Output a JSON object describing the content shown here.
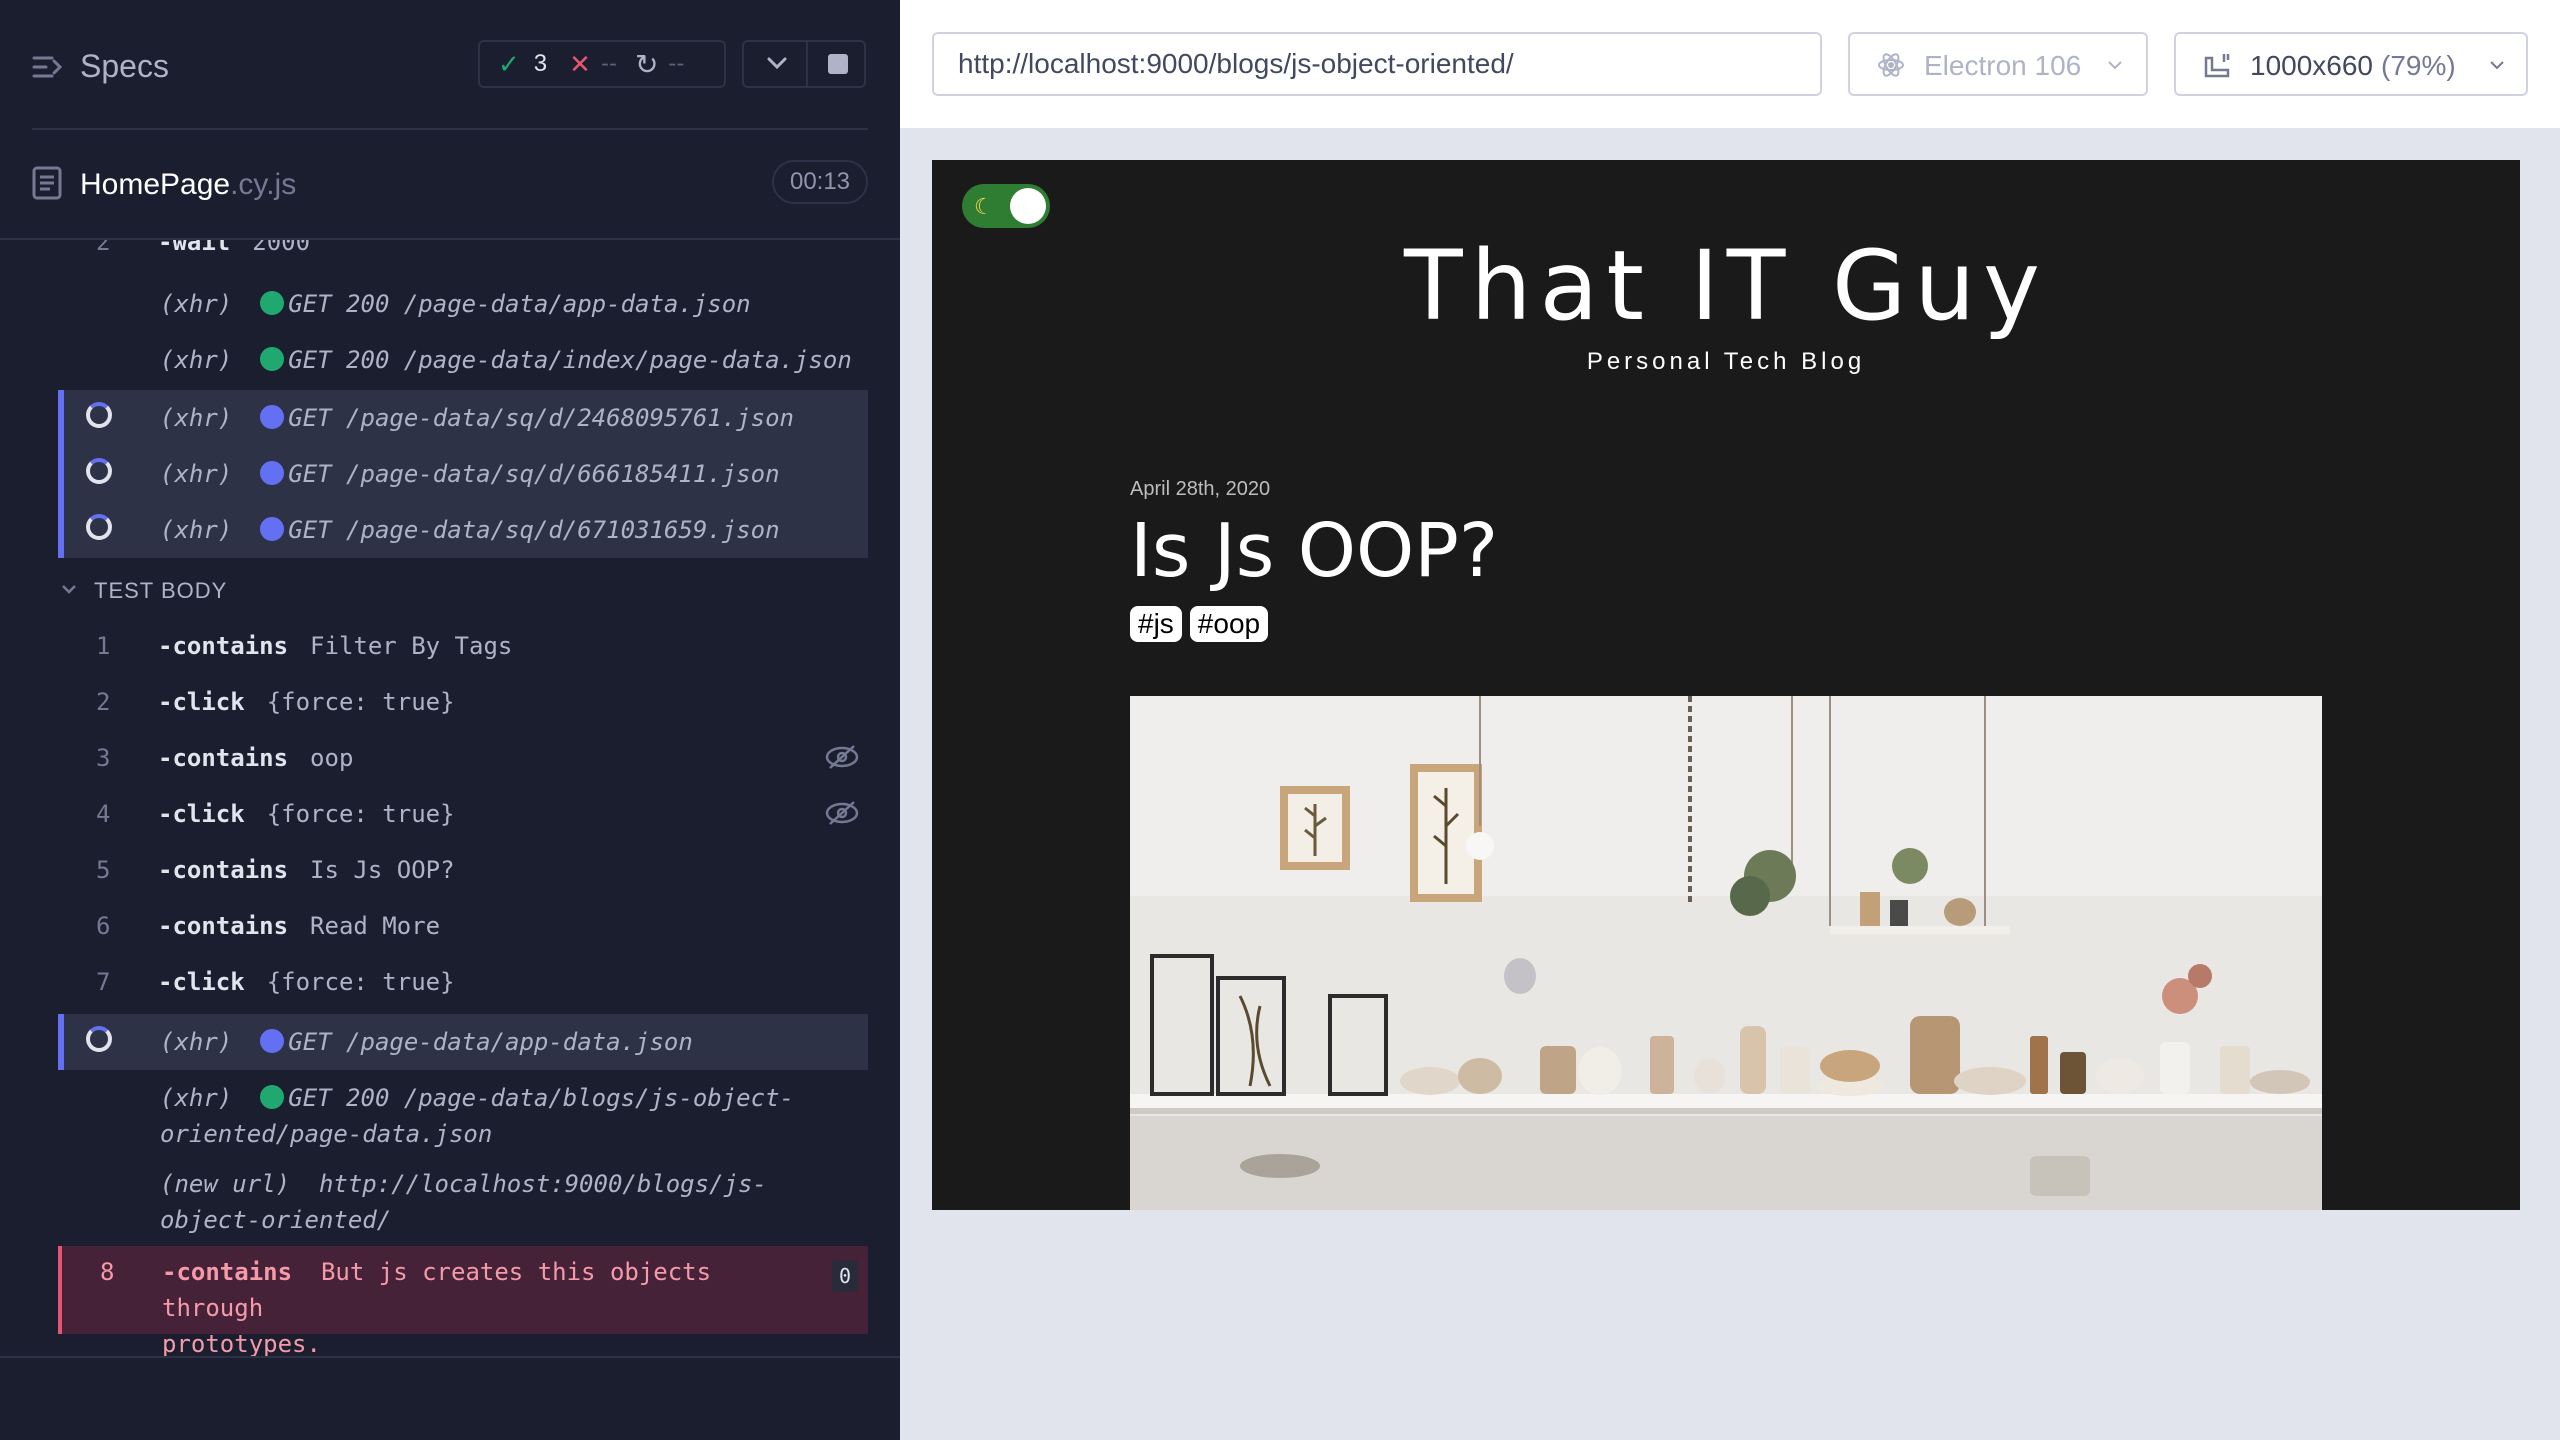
{
  "reporter": {
    "specs_label": "Specs",
    "stats": {
      "passed": "3",
      "failed": "--",
      "pending": "--"
    },
    "spec": {
      "name": "HomePage",
      "ext": ".cy.js",
      "duration": "00:13"
    },
    "partial_command": {
      "num": "2",
      "method": "-wait",
      "message": "2000"
    },
    "before_commands": [
      {
        "type": "(xhr)",
        "status": "GET 200 /page-data/app-data.json",
        "state": "done"
      },
      {
        "type": "(xhr)",
        "status": "GET 200 /page-data/index/page-data.json",
        "state": "done"
      },
      {
        "type": "(xhr)",
        "status": "GET /page-data/sq/d/2468095761.json",
        "state": "pending"
      },
      {
        "type": "(xhr)",
        "status": "GET /page-data/sq/d/666185411.json",
        "state": "pending"
      },
      {
        "type": "(xhr)",
        "status": "GET /page-data/sq/d/671031659.json",
        "state": "pending"
      }
    ],
    "test_body_label": "TEST BODY",
    "commands": [
      {
        "num": "1",
        "method": "-contains",
        "message": "Filter By Tags"
      },
      {
        "num": "2",
        "method": "-click",
        "message": "{force: true}"
      },
      {
        "num": "3",
        "method": "-contains",
        "message": "oop"
      },
      {
        "num": "4",
        "method": "-click",
        "message": "{force: true}"
      },
      {
        "num": "5",
        "method": "-contains",
        "message": "Is Js OOP?"
      },
      {
        "num": "6",
        "method": "-contains",
        "message": "Read More"
      },
      {
        "num": "7",
        "method": "-click",
        "message": "{force: true}"
      }
    ],
    "after_xhr": {
      "type": "(xhr)",
      "status": "GET /page-data/app-data.json"
    },
    "xhr_done_line1": "(xhr)  GET 200 /page-data/blogs/js-object-",
    "xhr_done_type": "(xhr)",
    "xhr_done_status": "GET 200 /page-data/blogs/js-object-",
    "xhr_done_line2": "oriented/page-data.json",
    "new_url_type": "(new url)",
    "new_url_line1": "http://localhost:9000/blogs/js-",
    "new_url_line2": "object-oriented/",
    "failed_command": {
      "num": "8",
      "method": "-contains",
      "message_line1": "But js creates this objects through",
      "message_line2": "prototypes.",
      "badge": "0"
    }
  },
  "aut": {
    "url": "http://localhost:9000/blogs/js-object-oriented/",
    "browser": "Electron 106",
    "viewport": "1000x660",
    "viewport_pct": "(79%)",
    "site": {
      "title": "That IT Guy",
      "subtitle": "Personal Tech Blog",
      "post_date": "April 28th, 2020",
      "post_title": "Is Js OOP?",
      "tags": [
        "#js",
        "#oop"
      ],
      "toggle_icon": "moon-icon"
    }
  },
  "colors": {
    "reporter_bg": "#1b1e2e",
    "pass": "#1fa971",
    "fail": "#e45770",
    "pending": "#6470f3",
    "aut_bg": "#e1e3ed",
    "site_bg": "#1a1a1a"
  }
}
